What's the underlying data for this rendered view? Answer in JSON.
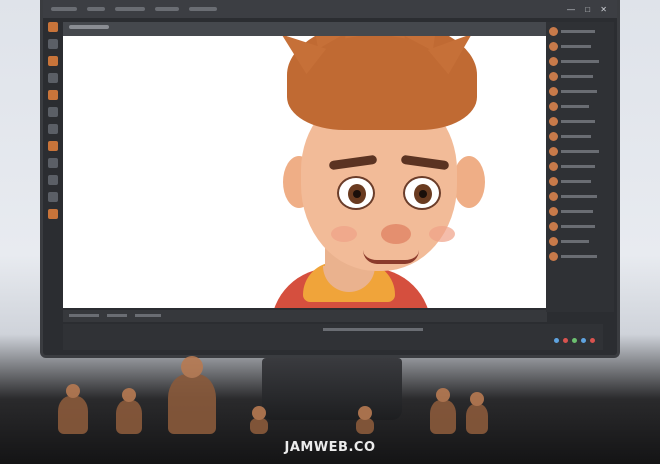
{
  "scene": {
    "description_tag": "monitor-with-3d-character",
    "colors": {
      "hair": "#c06a33",
      "skin": "#f2bb98",
      "shirt": "#d54f3e",
      "hood": "#f0a43a",
      "ui_dark": "#2b2d31"
    }
  },
  "watermark": {
    "text": "JAMWEB.CO"
  }
}
